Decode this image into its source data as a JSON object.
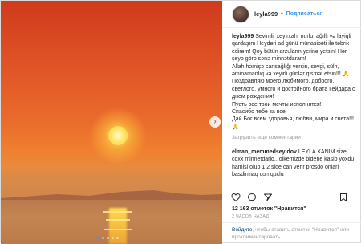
{
  "header": {
    "username": "leyla999",
    "separator": "•",
    "follow_label": "Подписаться"
  },
  "caption": {
    "username": "leyla999",
    "text": "Sevimli, xeyirxah, nurlu, ağıllı və layiqli qardaşım Heydəri ad günü münasibəti ilə təbrik edirəm! Qoy bütün arzuların yerinə yetsin! Hər şeyə görə sənə minnətdaram!\nAllah həmişə cansağlığı versin, sevgi, sülh, əminamanlıq və xeyirli günlər qismət etsin!!! 🙏\nПоздравляю моего любимого, доброго, светлого, умного и достойного брата Гейдара с днем рождения!\nПусть все твои мечты исполнятся!\nСпасибо тебе за все!\nДай Бог всем здоровья, любви, мира и света!!! 🙏"
  },
  "load_more": "Загрузить еще комментарии",
  "comments": [
    {
      "username": "elman_memmedseyidov",
      "text": "LEYLA XANIM size coxx minnetdariq.. olkemizde bidene kasib yoxdu hamisi olub 1 2 side can verir prosdo onlari basdirmaq cun quclu"
    }
  ],
  "likes": "12 163 отметок \"Нравится\"",
  "time": "2 часов назад",
  "add_comment": {
    "prefix": "",
    "link1": "Войдите",
    "middle": ", чтобы ставить отметки \"Нравится\" или прокомментировать."
  },
  "icons": {
    "like": "heart-icon",
    "comment": "comment-icon",
    "share": "share-icon",
    "save": "bookmark-icon",
    "next": "chevron-right-icon"
  },
  "colors": {
    "link": "#3897f0",
    "muted": "#999999"
  }
}
